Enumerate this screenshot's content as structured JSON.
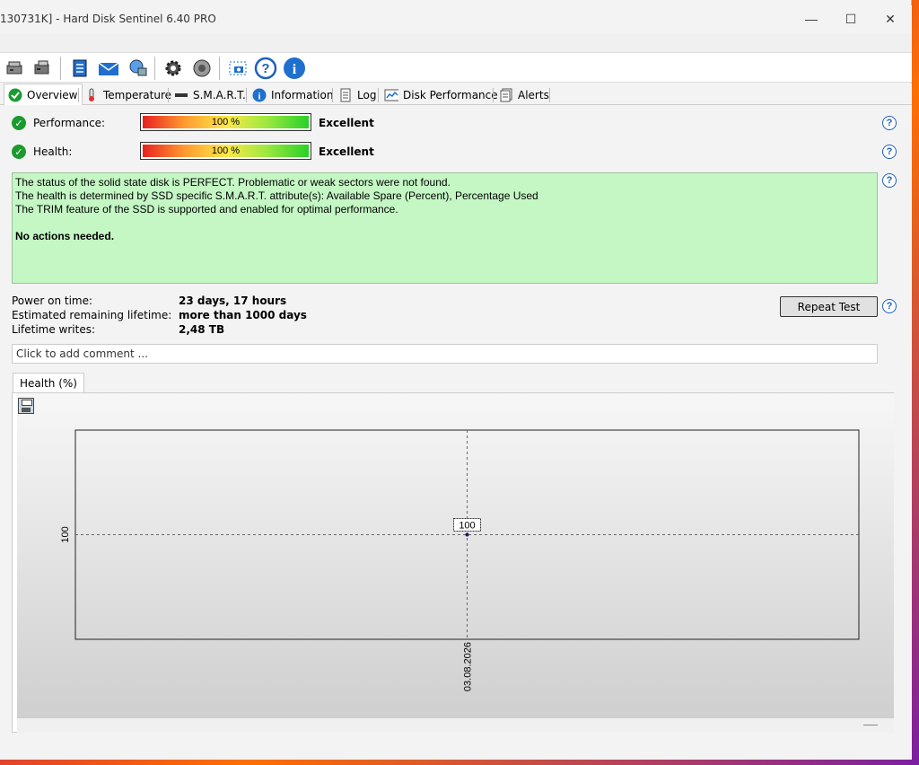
{
  "window": {
    "title": "130731K]  -  Hard Disk Sentinel 6.40 PRO",
    "controls": {
      "minimize": "—",
      "maximize": "☐",
      "close": "✕"
    }
  },
  "toolbar": {
    "icons": [
      "disk-icon",
      "disk-icon",
      "report-icon",
      "mail-icon",
      "network-icon",
      "gear-icon",
      "speaker-icon",
      "camera-icon",
      "help-icon",
      "info-icon"
    ]
  },
  "tabs": [
    {
      "label": "Overview",
      "icon": "check-icon",
      "active": true
    },
    {
      "label": "Temperature",
      "icon": "thermometer-icon"
    },
    {
      "label": "S.M.A.R.T.",
      "icon": "smart-icon"
    },
    {
      "label": "Information",
      "icon": "info-icon"
    },
    {
      "label": "Log",
      "icon": "log-icon"
    },
    {
      "label": "Disk Performance",
      "icon": "chart-icon"
    },
    {
      "label": "Alerts",
      "icon": "alerts-icon"
    }
  ],
  "overview": {
    "performance": {
      "label": "Performance:",
      "percent": 100,
      "percent_text": "100 %",
      "rating": "Excellent"
    },
    "health": {
      "label": "Health:",
      "percent": 100,
      "percent_text": "100 %",
      "rating": "Excellent"
    },
    "status_lines": [
      "The status of the solid state disk is PERFECT. Problematic or weak sectors were not found.",
      "The health is determined by SSD specific S.M.A.R.T. attribute(s):  Available Spare (Percent), Percentage Used",
      "The TRIM feature of the SSD is supported and enabled for optimal performance."
    ],
    "status_action": "No actions needed.",
    "power_on_label": "Power on time:",
    "power_on_value": "23 days, 17 hours",
    "lifetime_label": "Estimated remaining lifetime:",
    "lifetime_value": "more than 1000 days",
    "writes_label": "Lifetime writes:",
    "writes_value": "2,48 TB",
    "repeat_button": "Repeat Test",
    "comment_placeholder": "Click to add comment ..."
  },
  "chart_tab": "Health (%)",
  "chart_data": {
    "type": "line",
    "x": [
      "03.08.2026"
    ],
    "series": [
      {
        "values": [
          100
        ]
      }
    ],
    "data_labels": [
      "100"
    ],
    "y_tick_labels": [
      "100"
    ],
    "x_tick_labels": [
      "03.08.2026"
    ],
    "grid": true
  },
  "colors": {
    "status_background": "#c4f7c4",
    "ok_green": "#1a9b2e",
    "help_blue": "#1f5fbf"
  }
}
